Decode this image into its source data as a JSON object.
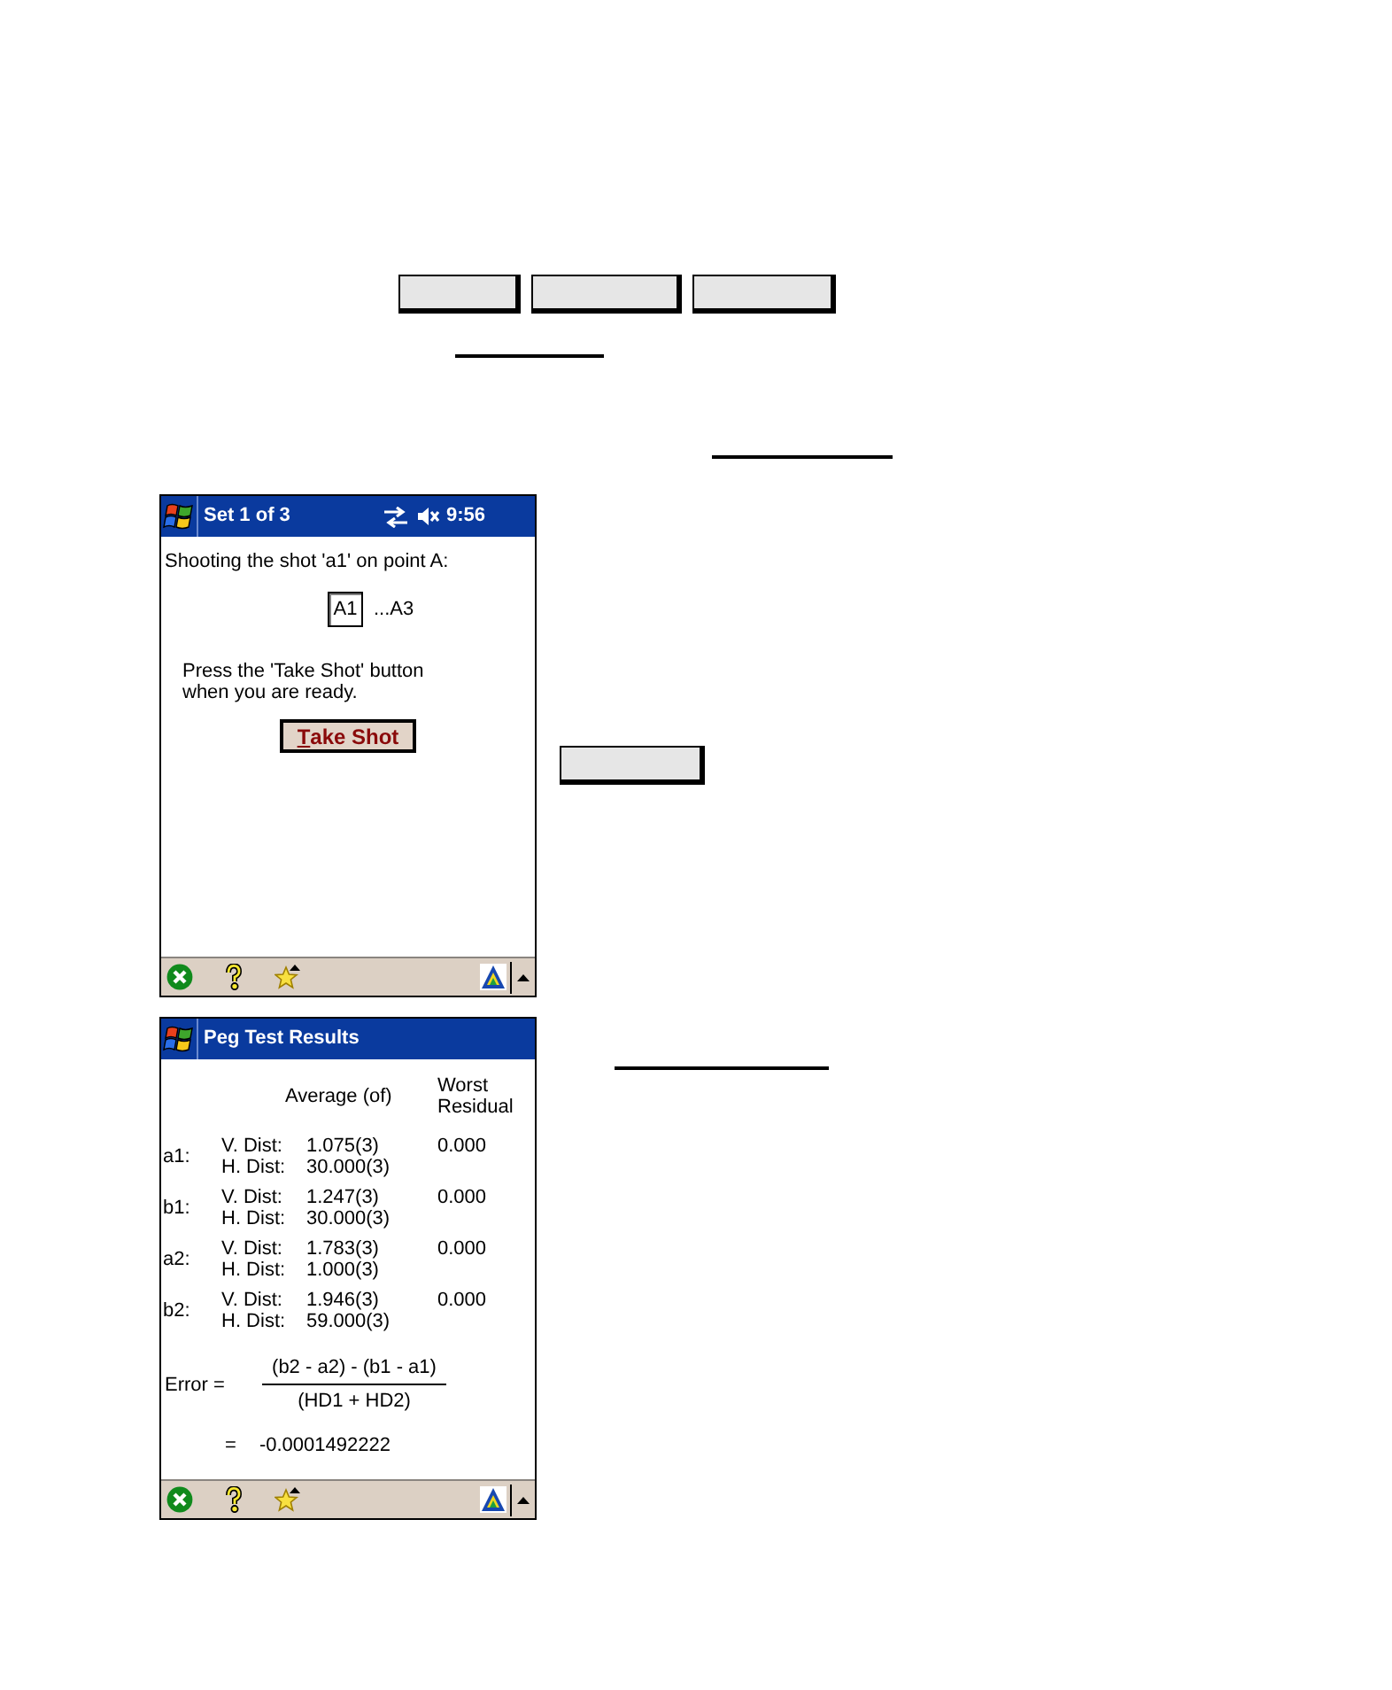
{
  "shot_screen": {
    "title_bar": {
      "title": "Set 1 of 3",
      "time": "9:56"
    },
    "instruction": "Shooting the shot 'a1' on point A:",
    "current_shot": "A1",
    "shot_range_end": "...A3",
    "prompt": "Press the 'Take Shot' button when you are ready.",
    "take_shot_button": {
      "accelerator": "T",
      "label_rest": "ake Shot"
    }
  },
  "results_screen": {
    "title_bar": {
      "title": "Peg Test Results"
    },
    "columns": [
      "Average (of)",
      "Worst Residual"
    ],
    "rows": [
      {
        "point": "a1:",
        "v_label": "V. Dist:",
        "v_value": "1.075(3)",
        "h_label": "H. Dist:",
        "h_value": "30.000(3)",
        "worst_residual": "0.000"
      },
      {
        "point": "b1:",
        "v_label": "V. Dist:",
        "v_value": "1.247(3)",
        "h_label": "H. Dist:",
        "h_value": "30.000(3)",
        "worst_residual": "0.000"
      },
      {
        "point": "a2:",
        "v_label": "V. Dist:",
        "v_value": "1.783(3)",
        "h_label": "H. Dist:",
        "h_value": "1.000(3)",
        "worst_residual": "0.000"
      },
      {
        "point": "b2:",
        "v_label": "V. Dist:",
        "v_value": "1.946(3)",
        "h_label": "H. Dist:",
        "h_value": "59.000(3)",
        "worst_residual": "0.000"
      }
    ],
    "formula": {
      "label": "Error =",
      "numerator": "(b2 - a2) - (b1 - a1)",
      "denominator": "(HD1 + HD2)",
      "equals": "=",
      "result": "-0.0001492222"
    }
  }
}
